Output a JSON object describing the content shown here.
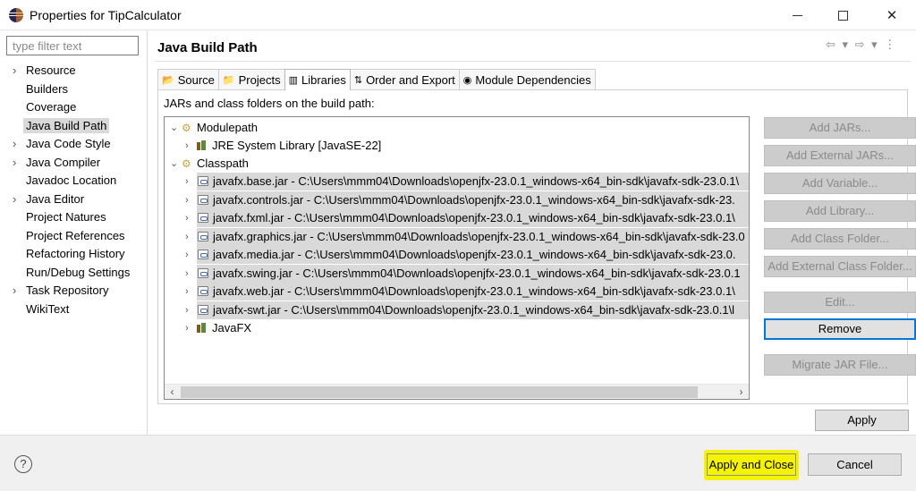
{
  "window": {
    "title": "Properties for TipCalculator",
    "minimize_label": "",
    "maximize_label": "",
    "close_label": "✕"
  },
  "sidebar": {
    "filter_placeholder": "type filter text",
    "items": [
      {
        "label": "Resource",
        "expandable": true
      },
      {
        "label": "Builders",
        "expandable": false
      },
      {
        "label": "Coverage",
        "expandable": false
      },
      {
        "label": "Java Build Path",
        "expandable": false,
        "selected": true
      },
      {
        "label": "Java Code Style",
        "expandable": true
      },
      {
        "label": "Java Compiler",
        "expandable": true
      },
      {
        "label": "Javadoc Location",
        "expandable": false
      },
      {
        "label": "Java Editor",
        "expandable": true
      },
      {
        "label": "Project Natures",
        "expandable": false
      },
      {
        "label": "Project References",
        "expandable": false
      },
      {
        "label": "Refactoring History",
        "expandable": false
      },
      {
        "label": "Run/Debug Settings",
        "expandable": false
      },
      {
        "label": "Task Repository",
        "expandable": true
      },
      {
        "label": "WikiText",
        "expandable": false
      }
    ]
  },
  "main": {
    "title": "Java Build Path",
    "history_nav": "⇦ ▾ ⇨ ▾ ⋮",
    "tabs": [
      {
        "label": "Source",
        "icon": "source-folder-icon",
        "glyph": "📂"
      },
      {
        "label": "Projects",
        "icon": "projects-icon",
        "glyph": "📁"
      },
      {
        "label": "Libraries",
        "icon": "libraries-icon",
        "glyph": "▥",
        "active": true
      },
      {
        "label": "Order and Export",
        "icon": "order-export-icon",
        "glyph": "⇅"
      },
      {
        "label": "Module Dependencies",
        "icon": "module-dependencies-icon",
        "glyph": "◉"
      }
    ],
    "panel_label": "JARs and class folders on the build path:",
    "tree": {
      "modulepath": {
        "label": "Modulepath",
        "toggle": "⌄"
      },
      "jre": {
        "label": "JRE System Library [JavaSE-22]",
        "toggle": "›"
      },
      "classpath": {
        "label": "Classpath",
        "toggle": "⌄"
      },
      "jars": [
        {
          "label": "javafx.base.jar - C:\\Users\\mmm04\\Downloads\\openjfx-23.0.1_windows-x64_bin-sdk\\javafx-sdk-23.0.1\\"
        },
        {
          "label": "javafx.controls.jar - C:\\Users\\mmm04\\Downloads\\openjfx-23.0.1_windows-x64_bin-sdk\\javafx-sdk-23."
        },
        {
          "label": "javafx.fxml.jar - C:\\Users\\mmm04\\Downloads\\openjfx-23.0.1_windows-x64_bin-sdk\\javafx-sdk-23.0.1\\"
        },
        {
          "label": "javafx.graphics.jar - C:\\Users\\mmm04\\Downloads\\openjfx-23.0.1_windows-x64_bin-sdk\\javafx-sdk-23.0"
        },
        {
          "label": "javafx.media.jar - C:\\Users\\mmm04\\Downloads\\openjfx-23.0.1_windows-x64_bin-sdk\\javafx-sdk-23.0."
        },
        {
          "label": "javafx.swing.jar - C:\\Users\\mmm04\\Downloads\\openjfx-23.0.1_windows-x64_bin-sdk\\javafx-sdk-23.0.1"
        },
        {
          "label": "javafx.web.jar - C:\\Users\\mmm04\\Downloads\\openjfx-23.0.1_windows-x64_bin-sdk\\javafx-sdk-23.0.1\\"
        },
        {
          "label": "javafx-swt.jar - C:\\Users\\mmm04\\Downloads\\openjfx-23.0.1_windows-x64_bin-sdk\\javafx-sdk-23.0.1\\l"
        }
      ],
      "javafx": {
        "label": "JavaFX",
        "toggle": "›"
      },
      "scroll_left": "‹",
      "scroll_right": "›"
    },
    "buttons": {
      "add_jars": "Add JARs...",
      "add_external_jars": "Add External JARs...",
      "add_variable": "Add Variable...",
      "add_library": "Add Library...",
      "add_class_folder": "Add Class Folder...",
      "add_external_class_folder": "Add External Class Folder...",
      "edit": "Edit...",
      "remove": "Remove",
      "migrate_jar": "Migrate JAR File...",
      "apply": "Apply"
    }
  },
  "footer": {
    "help_label": "?",
    "apply_and_close": "Apply and Close",
    "cancel": "Cancel",
    "highlight_color": "#f5f300"
  }
}
